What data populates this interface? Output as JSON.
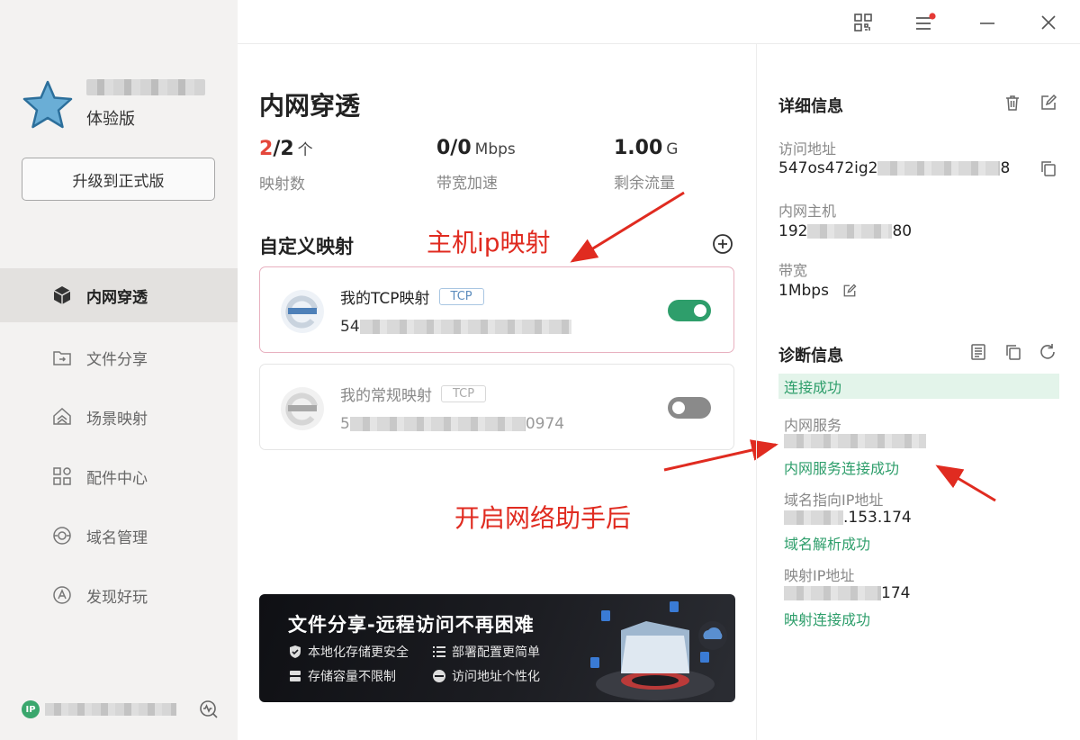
{
  "user": {
    "tier": "体验版",
    "upgrade_label": "升级到正式版"
  },
  "nav": [
    {
      "label": "内网穿透",
      "icon": "cube-icon",
      "active": true
    },
    {
      "label": "文件分享",
      "icon": "folder-share-icon",
      "active": false
    },
    {
      "label": "场景映射",
      "icon": "home-layers-icon",
      "active": false
    },
    {
      "label": "配件中心",
      "icon": "grid-apps-icon",
      "active": false
    },
    {
      "label": "域名管理",
      "icon": "globe-icon",
      "active": false
    },
    {
      "label": "发现好玩",
      "icon": "compass-icon",
      "active": false
    }
  ],
  "footer": {
    "ip_badge": "IP"
  },
  "main": {
    "title": "内网穿透",
    "stats": [
      {
        "value_hl": "2",
        "value_rest": "/2",
        "unit": "个",
        "label": "映射数"
      },
      {
        "value_hl": "",
        "value_rest": "0/0",
        "unit": "Mbps",
        "label": "带宽加速"
      },
      {
        "value_hl": "",
        "value_rest": "1.00",
        "unit": "G",
        "label": "剩余流量"
      }
    ],
    "section_title": "自定义映射",
    "mappings": [
      {
        "name": "我的TCP映射",
        "protocol": "TCP",
        "addr_prefix": "54",
        "addr_suffix": "",
        "enabled": true
      },
      {
        "name": "我的常规映射",
        "protocol": "TCP",
        "addr_prefix": "5",
        "addr_suffix": "0974",
        "enabled": false
      }
    ],
    "annotations": {
      "host_ip": "主机ip映射",
      "after_helper": "开启网络助手后"
    },
    "banner": {
      "title": "文件分享-远程访问不再困难",
      "features": [
        "本地化存储更安全",
        "部署配置更简单",
        "存储容量不限制",
        "访问地址个性化"
      ]
    }
  },
  "detail": {
    "title": "详细信息",
    "access_label": "访问地址",
    "access_prefix": "547os472ig2",
    "access_suffix": "8",
    "host_label": "内网主机",
    "host_prefix": "192",
    "host_suffix": "80",
    "bandwidth_label": "带宽",
    "bandwidth_value": "1Mbps"
  },
  "diagnosis": {
    "title": "诊断信息",
    "status": "连接成功",
    "items": [
      {
        "label": "内网服务",
        "value_prefix": "",
        "value_suffix": "",
        "status": "内网服务连接成功"
      },
      {
        "label": "域名指向IP地址",
        "value_prefix": "",
        "value_suffix": ".153.174",
        "status": "域名解析成功"
      },
      {
        "label": "映射IP地址",
        "value_prefix": "",
        "value_suffix": "174",
        "status": "映射连接成功"
      }
    ]
  },
  "colors": {
    "accent_green": "#2e9e6b",
    "highlight_red": "#e4473b",
    "annotation_red": "#e02b20",
    "sidebar_bg": "#f3f2f1"
  }
}
